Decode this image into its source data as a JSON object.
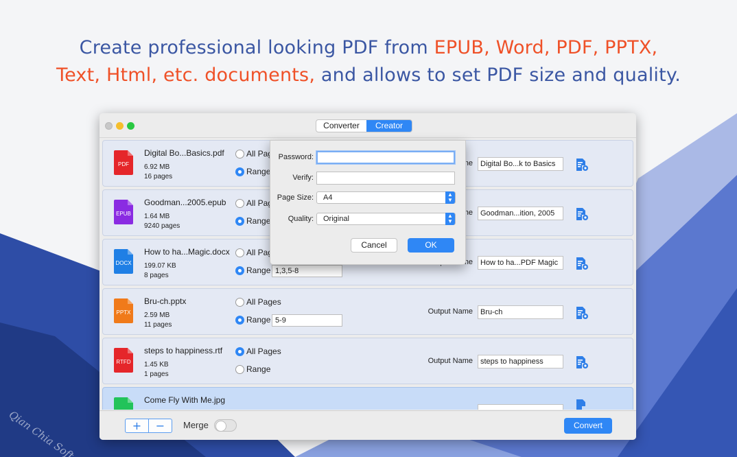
{
  "headline": {
    "part1": "Create professional looking PDF from ",
    "part2": "EPUB, Word, PDF, PPTX,",
    "part3": "Text, Html, etc. documents,",
    "part4": " and allows to set PDF size and quality."
  },
  "watermark": "Qian Chia Soft",
  "window": {
    "tabs": [
      "Converter",
      "Creator"
    ],
    "active_tab": "Creator"
  },
  "files": [
    {
      "name": "Digital Bo...Basics.pdf",
      "size": "6.92 MB",
      "pages": "16 pages",
      "type": "PDF",
      "color": "#e5262a",
      "all_pages": "All Pages",
      "range_label": "Range",
      "mode": "range",
      "range": "",
      "output_label": "Output Name",
      "output": "Digital Bo...k to Basics"
    },
    {
      "name": "Goodman...2005.epub",
      "size": "1.64 MB",
      "pages": "9240 pages",
      "type": "EPUB",
      "color": "#8a2be2",
      "all_pages": "All Pages",
      "range_label": "Range",
      "mode": "range",
      "range": "",
      "output_label": "Output Name",
      "output": "Goodman...ition, 2005"
    },
    {
      "name": "How to ha...Magic.docx",
      "size": "199.07 KB",
      "pages": "8 pages",
      "type": "DOCX",
      "color": "#1f7fe5",
      "all_pages": "All Pages",
      "range_label": "Range",
      "mode": "range",
      "range": "1,3,5-8",
      "output_label": "Output Name",
      "output": "How to ha...PDF Magic"
    },
    {
      "name": "Bru-ch.pptx",
      "size": "2.59 MB",
      "pages": "11 pages",
      "type": "PPTX",
      "color": "#f07a1a",
      "all_pages": "All Pages",
      "range_label": "Range",
      "mode": "range",
      "range": "5-9",
      "output_label": "Output Name",
      "output": "Bru-ch"
    },
    {
      "name": "steps to happiness.rtf",
      "size": "1.45 KB",
      "pages": "1 pages",
      "type": "RTFD",
      "color": "#e5262a",
      "all_pages": "All Pages",
      "range_label": "Range",
      "mode": "all",
      "range": "",
      "output_label": "Output Name",
      "output": "steps to happiness"
    },
    {
      "name": "Come Fly With Me.jpg",
      "size": "",
      "pages": "",
      "type": "",
      "color": "#22c35a",
      "all_pages": "",
      "range_label": "",
      "mode": "",
      "range": "",
      "output_label": "",
      "output": ""
    }
  ],
  "bottom": {
    "plus": "+",
    "minus": "−",
    "merge_label": "Merge",
    "merge_on": false,
    "convert_label": "Convert"
  },
  "dialog": {
    "password_label": "Password:",
    "password_value": "",
    "verify_label": "Verify:",
    "verify_value": "",
    "page_size_label": "Page Size:",
    "page_size_value": "A4",
    "quality_label": "Quality:",
    "quality_value": "Original",
    "cancel_label": "Cancel",
    "ok_label": "OK"
  },
  "colors": {
    "accent": "#2f87f5",
    "headline_blue": "#3b57a3",
    "headline_orange": "#ef5128"
  }
}
